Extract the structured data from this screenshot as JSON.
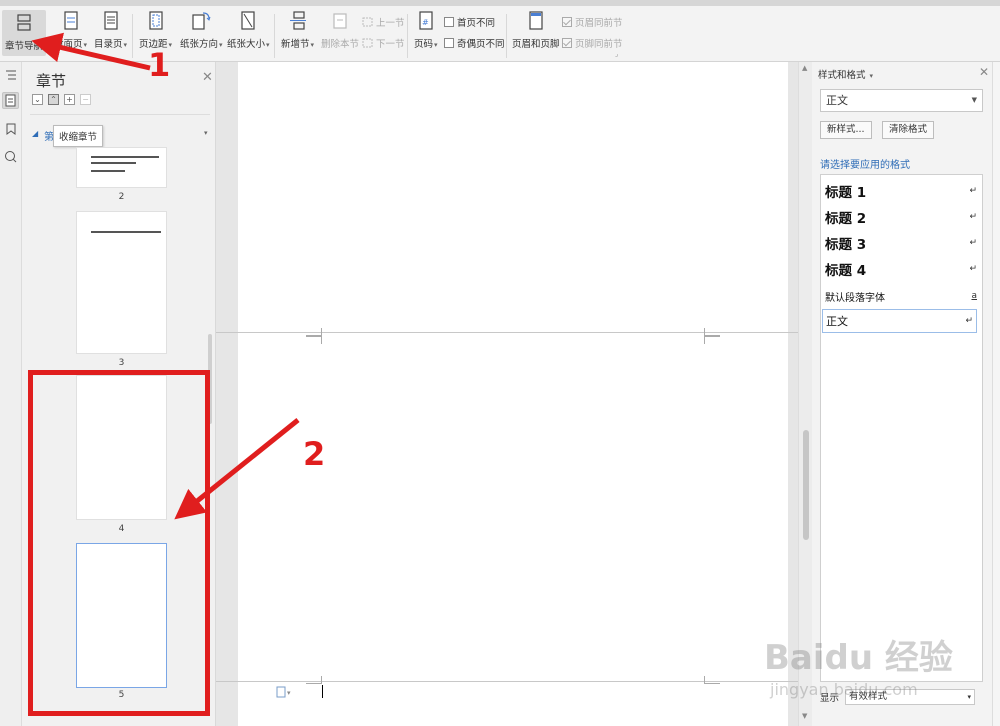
{
  "ribbon": {
    "buttons": [
      {
        "label": "章节导航",
        "icon": "section-nav-icon"
      },
      {
        "label": "封面页",
        "icon": "cover-page-icon"
      },
      {
        "label": "目录页",
        "icon": "toc-page-icon"
      },
      {
        "label": "页边距",
        "icon": "margins-icon"
      },
      {
        "label": "纸张方向",
        "icon": "orientation-icon"
      },
      {
        "label": "纸张大小",
        "icon": "paper-size-icon"
      },
      {
        "label": "新增节",
        "icon": "new-section-icon"
      },
      {
        "label": "删除本节",
        "icon": "delete-section-icon"
      },
      {
        "label": "页码",
        "icon": "page-number-icon"
      },
      {
        "label": "页眉和页脚",
        "icon": "header-footer-icon"
      }
    ],
    "prev_section": "上一节",
    "next_section": "下一节",
    "first_page_diff": "首页不同",
    "odd_even_diff": "奇偶页不同",
    "header_same_prev": "页眉同前节",
    "footer_same_prev": "页脚同前节"
  },
  "nav": {
    "title": "章节",
    "section_label": "第",
    "section_label_tail": "5",
    "tooltip": "收缩章节",
    "pages": [
      "2",
      "3",
      "4",
      "5"
    ]
  },
  "styles_panel": {
    "title": "样式和格式",
    "current_style": "正文",
    "new_style_btn": "新样式...",
    "clear_format_btn": "清除格式",
    "hint": "请选择要应用的格式",
    "items": [
      {
        "name": "标题 1",
        "mark": "↵"
      },
      {
        "name": "标题 2",
        "mark": "↵"
      },
      {
        "name": "标题 3",
        "mark": "↵"
      },
      {
        "name": "标题 4",
        "mark": "↵"
      },
      {
        "name": "默认段落字体",
        "mark": "a"
      },
      {
        "name": "正文",
        "mark": "↵"
      }
    ],
    "show_label": "显示",
    "show_value": "有效样式"
  },
  "annotations": {
    "label_1": "1",
    "label_2": "2",
    "color": "#e01e1e"
  },
  "watermark": {
    "brand": "Bai",
    "brand_mid": "du",
    "brand_cn": "经验",
    "url": "jingyan.baidu.com"
  }
}
